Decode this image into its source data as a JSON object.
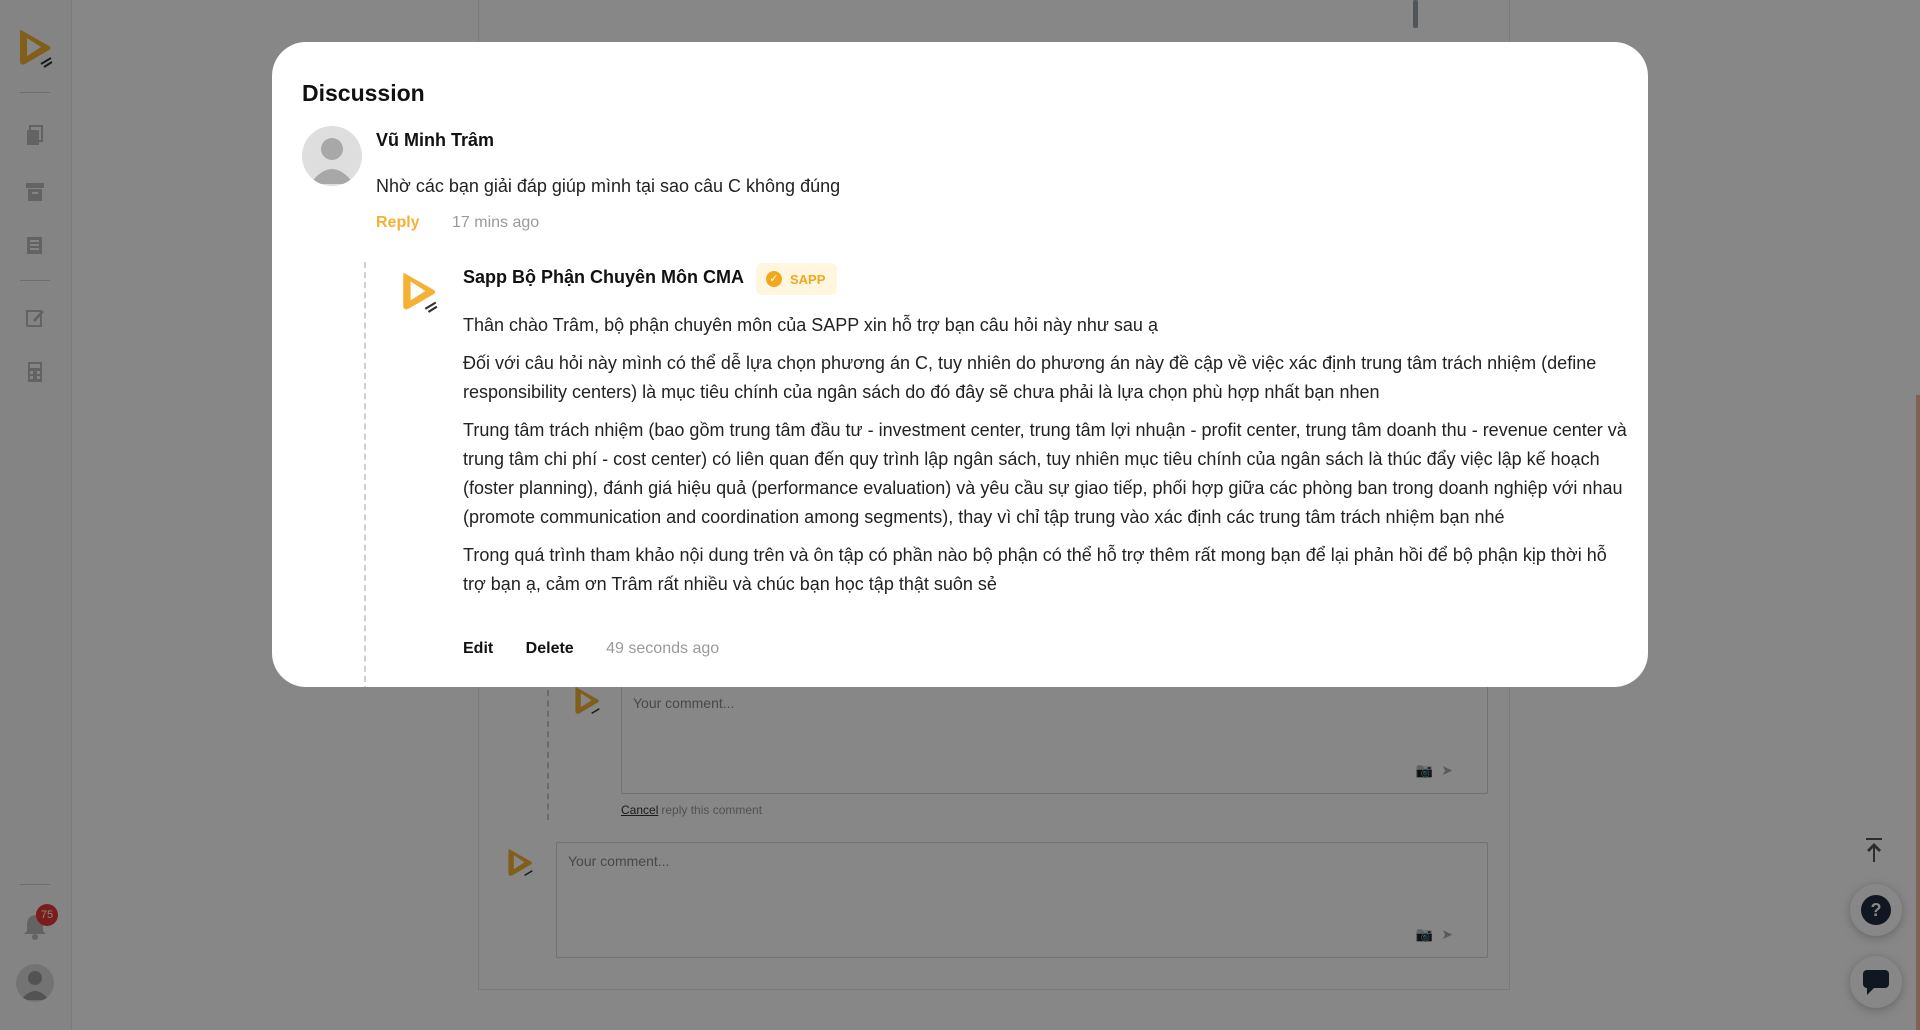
{
  "sidebar": {
    "notification_count": "75",
    "icons": [
      "documents-icon",
      "archive-icon",
      "books-icon",
      "edit-note-icon",
      "calculator-icon"
    ]
  },
  "background": {
    "reply_placeholder": "Your comment...",
    "cancel_label": "Cancel",
    "cancel_suffix": "reply this comment",
    "main_placeholder": "Your comment..."
  },
  "modal": {
    "title": "Discussion",
    "comment": {
      "author": "Vũ Minh Trâm",
      "text": "Nhờ các bạn giải đáp giúp mình tại sao câu C không đúng",
      "reply_label": "Reply",
      "time": "17 mins ago"
    },
    "reply": {
      "author": "Sapp Bộ Phận Chuyên Môn CMA",
      "badge": "SAPP",
      "paragraphs": [
        "Thân chào Trâm, bộ phận chuyên môn của SAPP xin hỗ trợ bạn câu hỏi này như sau ạ",
        "Đối với câu hỏi này mình có thể dễ lựa chọn phương án C, tuy nhiên do phương án này đề cập về việc xác định trung tâm trách nhiệm (define responsibility centers) là mục tiêu chính của ngân sách do đó đây sẽ chưa phải là lựa chọn phù hợp nhất bạn nhen",
        "Trung tâm trách nhiệm (bao gồm trung tâm đầu tư - investment center, trung tâm lợi nhuận - profit center, trung tâm doanh thu - revenue center và trung tâm chi phí - cost center) có liên quan đến quy trình lập ngân sách, tuy nhiên mục tiêu chính của ngân sách là thúc đẩy việc lập kế hoạch (foster planning), đánh giá hiệu quả (performance evaluation) và yêu cầu sự giao tiếp, phối hợp giữa các phòng ban trong doanh nghiệp với nhau (promote communication and coordination among segments), thay vì chỉ tập trung vào xác định các trung tâm trách nhiệm bạn nhé",
        "Trong quá trình tham khảo nội dung trên và ôn tập có phần nào bộ phận có thể hỗ trợ thêm rất mong bạn để lại phản hồi để bộ phận kịp thời hỗ trợ bạn ạ, cảm ơn Trâm rất nhiều và chúc bạn học tập thật suôn sẻ"
      ],
      "edit_label": "Edit",
      "delete_label": "Delete",
      "time": "49 seconds ago"
    }
  },
  "colors": {
    "accent": "#f5b133",
    "overlay": "rgba(0,0,0,0.47)"
  }
}
